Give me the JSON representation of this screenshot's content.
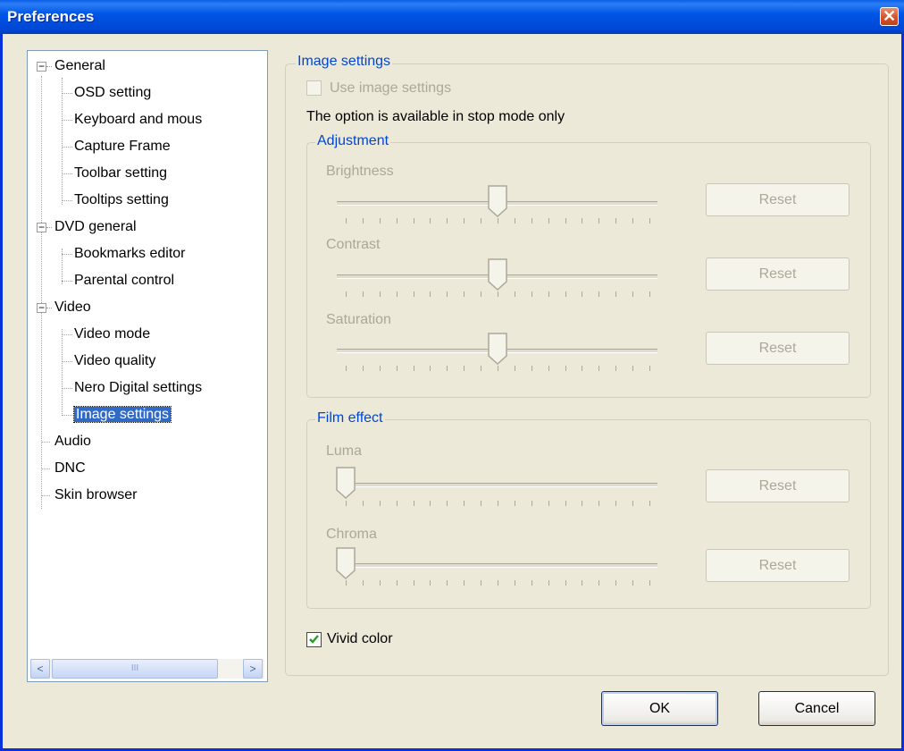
{
  "window": {
    "title": "Preferences",
    "close_glyph": "✕"
  },
  "tree": {
    "nodes": [
      {
        "label": "General",
        "expander": "−"
      },
      {
        "label": "OSD setting"
      },
      {
        "label": "Keyboard and mous"
      },
      {
        "label": "Capture Frame"
      },
      {
        "label": "Toolbar setting"
      },
      {
        "label": "Tooltips setting"
      },
      {
        "label": "DVD general",
        "expander": "−"
      },
      {
        "label": "Bookmarks editor"
      },
      {
        "label": "Parental control"
      },
      {
        "label": "Video",
        "expander": "−"
      },
      {
        "label": "Video mode"
      },
      {
        "label": "Video quality"
      },
      {
        "label": "Nero Digital settings"
      },
      {
        "label": "Image settings",
        "selected": true
      },
      {
        "label": "Audio"
      },
      {
        "label": "DNC"
      },
      {
        "label": "Skin browser"
      }
    ],
    "scroll_left": "<",
    "scroll_right": ">",
    "scroll_grip": "III"
  },
  "image_settings": {
    "legend": "Image settings",
    "use_label": "Use image settings",
    "use_checked": false,
    "note": "The option is available in stop mode only"
  },
  "adjustment": {
    "legend": "Adjustment",
    "brightness": {
      "label": "Brightness",
      "level": 0.5,
      "reset": "Reset"
    },
    "contrast": {
      "label": "Contrast",
      "level": 0.5,
      "reset": "Reset"
    },
    "saturation": {
      "label": "Saturation",
      "level": 0.5,
      "reset": "Reset"
    }
  },
  "film_effect": {
    "legend": "Film effect",
    "luma": {
      "label": "Luma",
      "level": 0.0,
      "reset": "Reset"
    },
    "chroma": {
      "label": "Chroma",
      "level": 0.0,
      "reset": "Reset"
    }
  },
  "vivid": {
    "label": "Vivid color",
    "checked": true
  },
  "buttons": {
    "ok": "OK",
    "cancel": "Cancel"
  },
  "colors": {
    "title_blue": "#0055e5",
    "legend_blue": "#0046d5",
    "selected_blue": "#316ac5",
    "disabled_grey": "#aca899",
    "check_green": "#21a121"
  }
}
